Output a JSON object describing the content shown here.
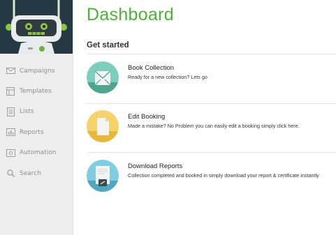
{
  "page": {
    "title": "Dashboard"
  },
  "sidebar": {
    "items": [
      {
        "label": "Campaigns",
        "icon": "mail-icon"
      },
      {
        "label": "Templates",
        "icon": "templates-icon"
      },
      {
        "label": "Lists",
        "icon": "list-icon"
      },
      {
        "label": "Reports",
        "icon": "bar-chart-icon"
      },
      {
        "label": "Automation",
        "icon": "automation-icon"
      },
      {
        "label": "Search",
        "icon": "search-icon"
      }
    ]
  },
  "main": {
    "section_title": "Get started",
    "cards": [
      {
        "title": "Book Collection",
        "description": "Ready for a new collection? Lets go",
        "icon": "envelope-icon",
        "color": "#7ccfbd"
      },
      {
        "title": "Edit Booking",
        "description": "Made a mistake? No Problem you can easily edit a booking simply click here.",
        "icon": "document-icon",
        "color": "#f6d26a"
      },
      {
        "title": "Download Reports",
        "description": "Collection completed and booked in simply download your report & certificate instantly",
        "icon": "report-icon",
        "color": "#7fcde2"
      }
    ]
  },
  "colors": {
    "accent": "#49b531",
    "sidebar_bg": "#eeeeee",
    "logo_bg": "#243943"
  }
}
